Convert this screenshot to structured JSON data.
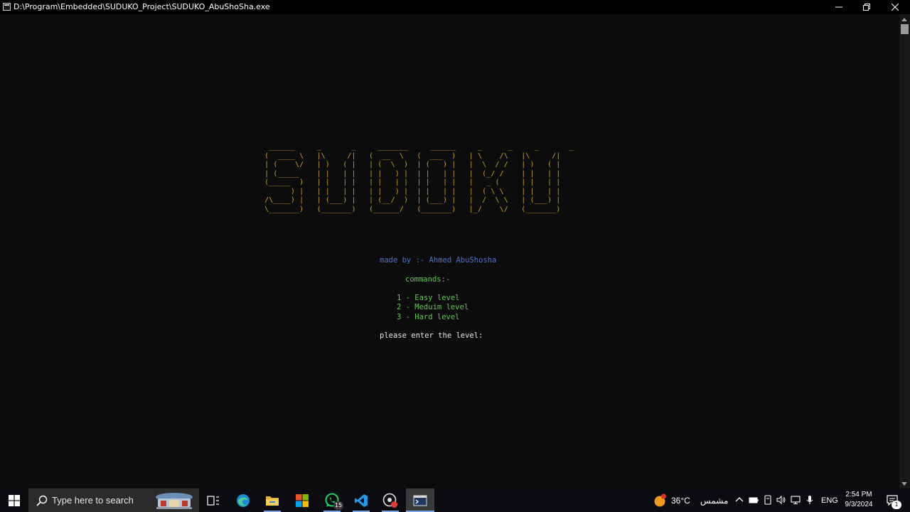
{
  "window": {
    "title": "D:\\Program\\Embedded\\SUDUKO_Project\\SUDUKO_AbuShoSha.exe"
  },
  "console": {
    "banner_lines": [
      "  ______     _       _     _______     ______     _      _     _       _",
      " (  ____ \\   |\\     /|   (  __  \\   (  ___  )   | \\    /\\   |\\     /|",
      " | (    \\/   | )   ( |   | (  \\  )  | (   ) |   |  \\  / /   | )   ( |",
      " | (_____    | |   | |   | |   ) |  | |   | |   |  (_/ /    | |   | |",
      " (_____  )   | |   | |   | |   | |  | |   | |   |   _ (     | |   | |",
      "       ) |   | |   | |   | |   ) |  | |   | |   |  ( \\ \\    | |   | |",
      " /\\____) |   | (___) |   | (__/  )  | (___) |   |  /  \\ \\   | (___) |",
      " \\_______)   (_______)   (______/   (_______)   |_/    \\/   (_______)"
    ],
    "credit": "made by :- Ahmed AbuShosha",
    "commands_label": "commands:-",
    "options": [
      "1 - Easy level",
      "2 - Meduim level",
      "3 - Hard level"
    ],
    "prompt": "please enter the level:"
  },
  "taskbar": {
    "search_placeholder": "Type here to search",
    "whatsapp_badge": "15",
    "weather_temp": "36°C",
    "weather_desc": "مشمس",
    "weather_alert": "1",
    "language": "ENG",
    "time": "2:54 PM",
    "date": "9/3/2024",
    "notification_count": "1"
  },
  "colors": {
    "ascii": "#c9a227",
    "credit": "#4a73d8",
    "menu": "#62c554",
    "prompt": "#e8e8e8",
    "console_bg": "#0c0c0c"
  }
}
